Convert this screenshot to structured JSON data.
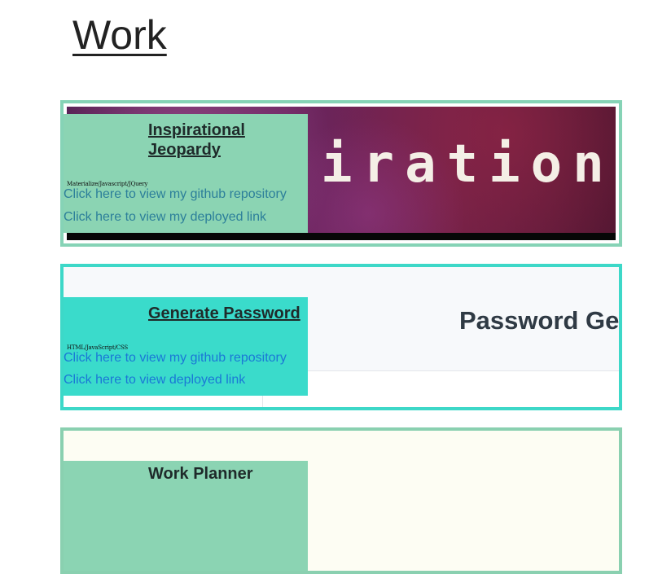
{
  "page": {
    "title": "Work"
  },
  "projects": [
    {
      "title": "Inspirational Jeopardy",
      "tech": "Materialize/Javascript/JQuery",
      "github_link": "Click here to view my github repository",
      "deployed_link": "Click here to view my deployed link",
      "thumbnail_text": "irational"
    },
    {
      "title": "Generate Password",
      "tech": "HTML/JavaScript/CSS",
      "github_link": "Click here to view my github repository",
      "deployed_link": "Click here to view deployed link",
      "thumbnail_text": "Password Ge"
    },
    {
      "title": "Work Planner"
    }
  ],
  "colors": {
    "card1_border": "#86d3b6",
    "card2_border": "#3dd8c8",
    "overlay_green": "#8bd4b3",
    "overlay_teal": "#3adbcb",
    "link_teal": "#2c7f9a",
    "link_blue": "#1a78d6"
  }
}
